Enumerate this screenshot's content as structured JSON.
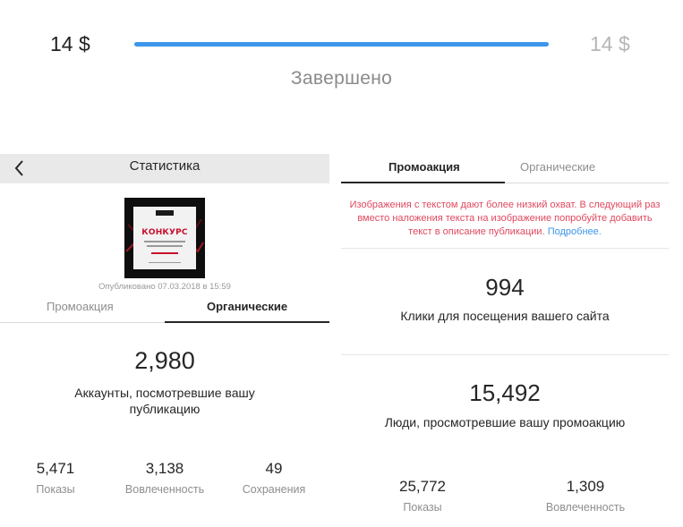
{
  "budget": {
    "spent_label": "14 $",
    "total_label": "14 $",
    "progress_percent": 100,
    "bar_color": "#3d96ea",
    "status": "Завершено"
  },
  "left_panel": {
    "title": "Статистика",
    "back_icon": "chevron-left-icon",
    "post": {
      "thumbnail_word": "КОНКУРС",
      "published": "Опубликовано 07.03.2018 в 15:59"
    },
    "tabs": [
      {
        "label": "Промоакция",
        "active": false
      },
      {
        "label": "Органические",
        "active": true
      }
    ],
    "main_stat": {
      "value": "2,980",
      "label": "Аккаунты, посмотревшие вашу публикацию"
    },
    "stats": [
      {
        "value": "5,471",
        "label": "Показы"
      },
      {
        "value": "3,138",
        "label": "Вовлеченность"
      },
      {
        "value": "49",
        "label": "Сохранения"
      }
    ]
  },
  "right_panel": {
    "tabs": [
      {
        "label": "Промоакция",
        "active": true
      },
      {
        "label": "Органические",
        "active": false
      }
    ],
    "warning": {
      "text": "Изображения с текстом дают более низкий охват. В следующий раз вместо наложения текста на изображение попробуйте добавить текст в описание публикации.",
      "link": "Подробнее.",
      "color": "#e0485e",
      "link_color": "#3d96ea"
    },
    "site_clicks": {
      "value": "994",
      "label": "Клики для посещения вашего сайта"
    },
    "people": {
      "value": "15,492",
      "label": "Люди, просмотревшие вашу промоакцию"
    },
    "stats": [
      {
        "value": "25,772",
        "label": "Показы"
      },
      {
        "value": "1,309",
        "label": "Вовлеченность"
      }
    ]
  }
}
